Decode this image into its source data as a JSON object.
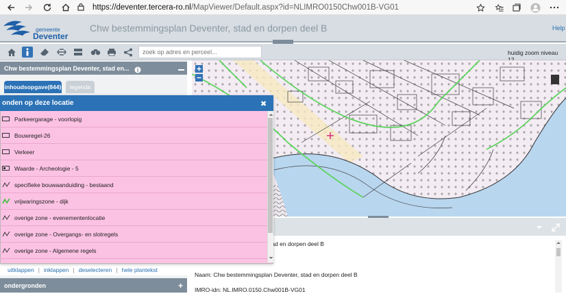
{
  "browser": {
    "url_host": "https://deventer.tercera-ro.nl",
    "url_path": "/MapViewer/Default.aspx?id=NLIMRO0150Chw001B-VG01"
  },
  "header": {
    "logo_line1": "gemeente",
    "logo_line2": "Deventer",
    "title": "Chw bestemmingsplan Deventer, stad en dorpen deel B",
    "help": "Help"
  },
  "toolbar": {
    "search_placeholder": "zoek op adres en perceel...",
    "zoom_level_text": "huidig zoom niveau 12"
  },
  "leftpanel": {
    "title": "Chw bestemmingsplan Deventer, stad en...",
    "tabs": [
      {
        "label": "inhoudsopgave(844)",
        "active": true
      },
      {
        "label": "legenda",
        "active": false
      }
    ],
    "links": [
      "uitklappen",
      "inklappen",
      "deselecteren",
      "hele plantekst"
    ],
    "ondergronden": "ondergronden"
  },
  "popup": {
    "title": "onden op deze locatie",
    "items": [
      {
        "label": "Parkeergarage - voorlopig",
        "icon": "rectangle-icon"
      },
      {
        "label": "Bouwregel-26",
        "icon": "rectangle-icon"
      },
      {
        "label": "Verkeer",
        "icon": "rectangle-icon"
      },
      {
        "label": "Waarde - Archeologie - 5",
        "icon": "hatched-rectangle-icon"
      },
      {
        "label": "specifieke bouwaanduiding - bestaand",
        "icon": "line-zigzag-icon"
      },
      {
        "label": "vrijwaringszone - dijk",
        "icon": "green-zigzag-icon"
      },
      {
        "label": "overige zone - evenementenlocatie",
        "icon": "line-zigzag-icon"
      },
      {
        "label": "overige zone - Overgangs- en slotregels",
        "icon": "line-zigzag-icon"
      },
      {
        "label": "overige zone - Algemene regels",
        "icon": "line-zigzag-icon"
      }
    ]
  },
  "lower": {
    "line1": "tad en dorpen deel B",
    "line2": "Naam: Chw bestemmingsplan Deventer, stad en dorpen deel B",
    "line3": "IMRO-idn: NL.IMRO.0150.Chw001B-VG01"
  },
  "colors": {
    "accent_blue": "#2c72b6",
    "popup_pink": "#fcc2e4",
    "panel_header": "#7e8d9b",
    "map_water": "#b9d6ef"
  }
}
